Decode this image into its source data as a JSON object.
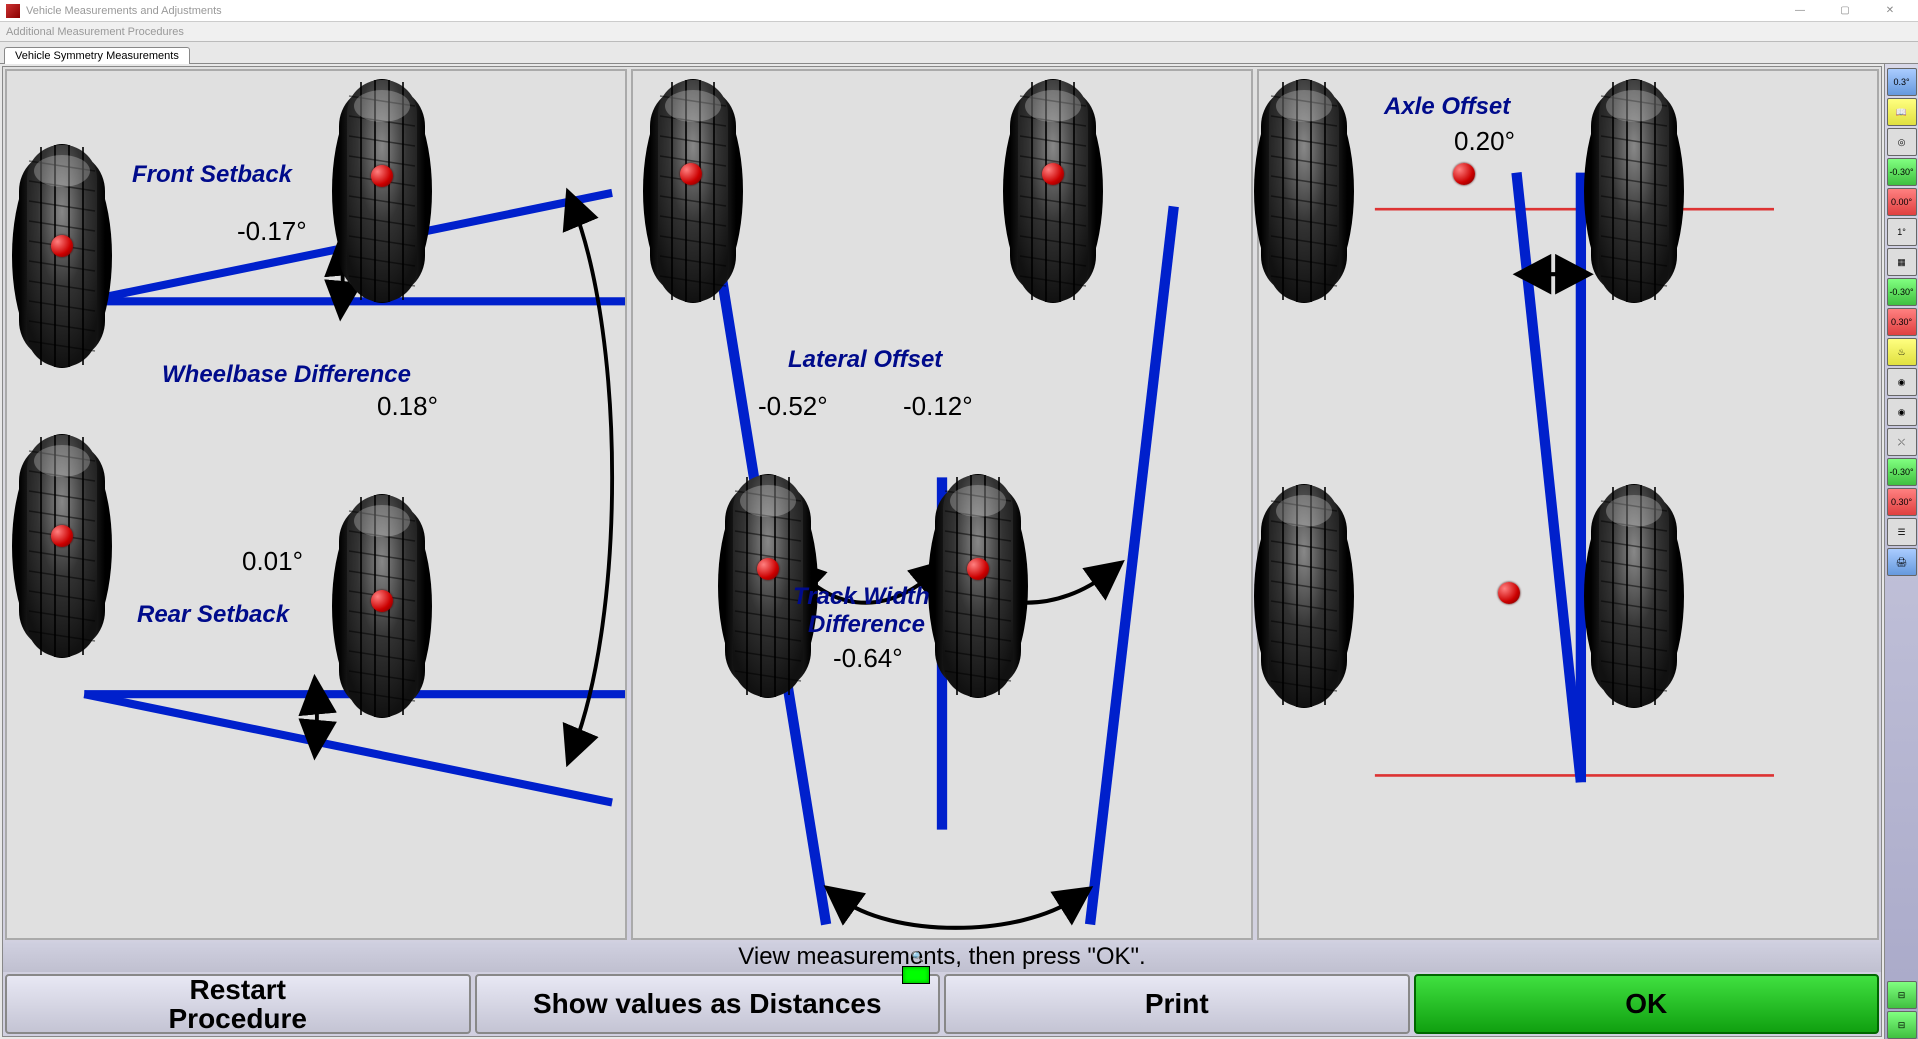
{
  "window": {
    "title": "Vehicle Measurements and Adjustments",
    "menu": "Additional Measurement Procedures",
    "tab": "Vehicle Symmetry Measurements"
  },
  "panel1": {
    "front_setback_label": "Front Setback",
    "front_setback_value": "-0.17°",
    "wheelbase_diff_label": "Wheelbase Difference",
    "wheelbase_diff_value": "0.18°",
    "rear_setback_label": "Rear Setback",
    "rear_setback_value": "0.01°"
  },
  "panel2": {
    "lateral_offset_label": "Lateral Offset",
    "lateral_offset_left": "-0.52°",
    "lateral_offset_right": "-0.12°",
    "track_width_label1": "Track Width",
    "track_width_label2": "Difference",
    "track_width_value": "-0.64°"
  },
  "panel3": {
    "axle_offset_label": "Axle Offset",
    "axle_offset_value": "0.20°"
  },
  "instruction": "View measurements, then press \"OK\".",
  "buttons": {
    "restart": "Restart\nProcedure",
    "show_dist": "Show values as Distances",
    "print": "Print",
    "ok": "OK"
  },
  "side_icons": [
    "0.3°",
    "book",
    "tgt",
    "-0.30°",
    "0.00°",
    "1°",
    "grid",
    "-0.30°",
    "0.30°",
    "susp",
    "wh1",
    "wh2",
    "cam",
    "-0.30°",
    "0.30°",
    "bars",
    "print"
  ]
}
